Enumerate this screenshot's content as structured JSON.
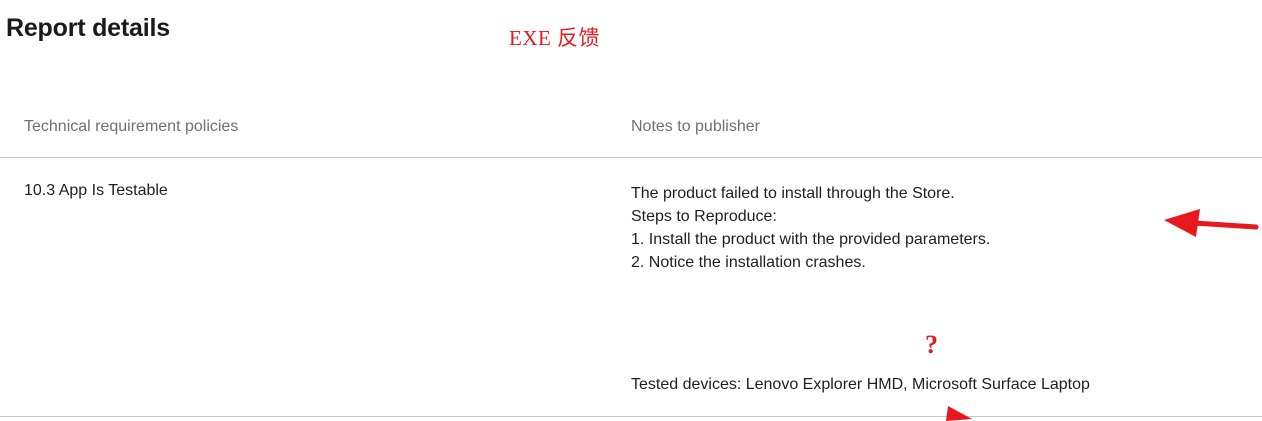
{
  "page": {
    "title": "Report details",
    "annotation_label": "EXE 反馈",
    "question_mark": "?"
  },
  "table": {
    "headers": {
      "policies": "Technical requirement policies",
      "notes": "Notes to publisher"
    },
    "rows": [
      {
        "policy": "10.3 App Is Testable",
        "notes": [
          "The product failed to install through the Store.",
          "Steps to Reproduce:",
          "1. Install the product with the provided parameters.",
          "2. Notice the installation crashes."
        ],
        "tested_devices": "Tested devices: Lenovo Explorer HMD, Microsoft Surface Laptop"
      }
    ]
  },
  "colors": {
    "annotation": "#e8191e",
    "header_text": "#707070",
    "divider": "#c8c8c8"
  },
  "icons": {
    "annotation_arrow_right": "red-arrow-icon",
    "annotation_arrow_bottom": "red-arrow-icon"
  }
}
